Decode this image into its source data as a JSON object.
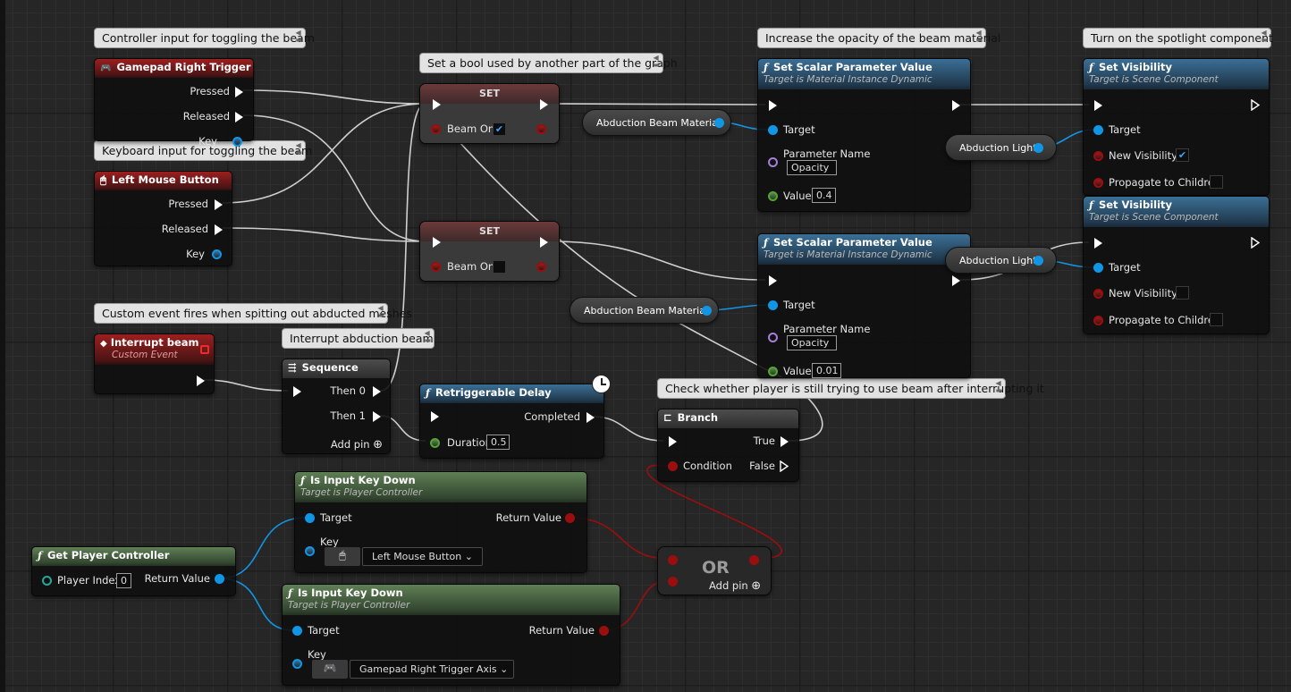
{
  "comments": {
    "gamepad": "Controller input for toggling the beam",
    "keyboard": "Keyboard input for toggling the beam",
    "set_bool": "Set a bool used by another part of the graph",
    "opacity": "Increase the opacity of the beam material",
    "spotlight": "Turn on the spotlight component",
    "custom_event": "Custom event fires when spitting out abducted meshes",
    "interrupt": "Interrupt abduction beam",
    "check": "Check whether player is still trying to use beam after interrupting it"
  },
  "nodes": {
    "gamepad": {
      "title": "Gamepad Right Trigger",
      "pressed": "Pressed",
      "released": "Released",
      "key": "Key"
    },
    "mouse": {
      "title": "Left Mouse Button",
      "pressed": "Pressed",
      "released": "Released",
      "key": "Key"
    },
    "set1": {
      "title": "SET",
      "var": "Beam On",
      "checked": "✔"
    },
    "set2": {
      "title": "SET",
      "var": "Beam On"
    },
    "scalar1": {
      "title": "Set Scalar Parameter Value",
      "subtitle": "Target is Material Instance Dynamic",
      "target": "Target",
      "param_label": "Parameter Name",
      "param_value": "Opacity",
      "value_label": "Value",
      "value": "0.4"
    },
    "scalar2": {
      "title": "Set Scalar Parameter Value",
      "subtitle": "Target is Material Instance Dynamic",
      "target": "Target",
      "param_label": "Parameter Name",
      "param_value": "Opacity",
      "value_label": "Value",
      "value": "0.01"
    },
    "vis1": {
      "title": "Set Visibility",
      "subtitle": "Target is Scene Component",
      "target": "Target",
      "new_vis": "New Visibility",
      "checked": "✔",
      "propagate": "Propagate to Children"
    },
    "vis2": {
      "title": "Set Visibility",
      "subtitle": "Target is Scene Component",
      "target": "Target",
      "new_vis": "New Visibility",
      "propagate": "Propagate to Children"
    },
    "beam_mat1": "Abduction Beam Material",
    "beam_mat2": "Abduction Beam Material",
    "light1": "Abduction Light",
    "light2": "Abduction Light",
    "interrupt": {
      "title": "Interrupt beam",
      "subtitle": "Custom Event"
    },
    "sequence": {
      "title": "Sequence",
      "then0": "Then 0",
      "then1": "Then 1",
      "add_pin": "Add pin"
    },
    "delay": {
      "title": "Retriggerable Delay",
      "completed": "Completed",
      "duration_label": "Duration",
      "duration": "0.5"
    },
    "branch": {
      "title": "Branch",
      "true_label": "True",
      "false_label": "False",
      "condition": "Condition"
    },
    "keydown1": {
      "title": "Is Input Key Down",
      "subtitle": "Target is Player Controller",
      "target": "Target",
      "return": "Return Value",
      "key_label": "Key",
      "key_value": "Left Mouse Button"
    },
    "keydown2": {
      "title": "Is Input Key Down",
      "subtitle": "Target is Player Controller",
      "target": "Target",
      "return": "Return Value",
      "key_label": "Key",
      "key_value": "Gamepad Right Trigger Axis"
    },
    "player_ctrl": {
      "title": "Get Player Controller",
      "index_label": "Player Index",
      "index": "0",
      "return": "Return Value"
    },
    "or": {
      "title": "OR",
      "add_pin": "Add pin"
    }
  },
  "icons": {
    "function": "ƒ",
    "gamepad": "🎮",
    "mouse": "🖱",
    "event": "◆",
    "chevron": "⌄",
    "add": "⊕"
  },
  "colors": {
    "exec": "#ffffff",
    "object_pin": "#1196e6",
    "bool_pin": "#9b0e0e",
    "float_pin": "#4ea82d",
    "name_pin": "#a57fd8",
    "int_pin": "#25a89a"
  }
}
